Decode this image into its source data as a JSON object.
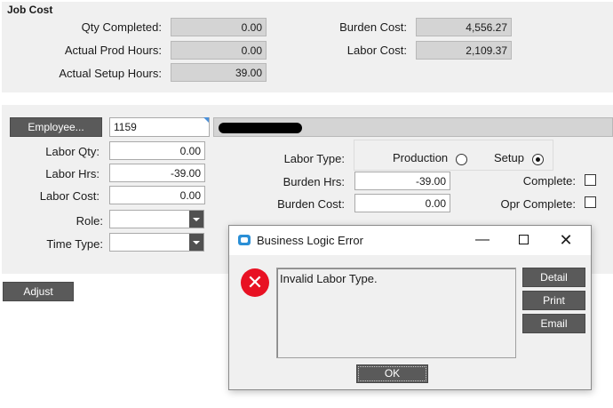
{
  "job_cost": {
    "title": "Job Cost",
    "qty_completed_label": "Qty Completed:",
    "qty_completed_value": "0.00",
    "actual_prod_hours_label": "Actual Prod Hours:",
    "actual_prod_hours_value": "0.00",
    "actual_setup_hours_label": "Actual Setup Hours:",
    "actual_setup_hours_value": "39.00",
    "burden_cost_label": "Burden Cost:",
    "burden_cost_value": "4,556.27",
    "labor_cost_label": "Labor Cost:",
    "labor_cost_value": "2,109.37"
  },
  "labor": {
    "employee_button": "Employee...",
    "employee_id": "1159",
    "labor_qty_label": "Labor Qty:",
    "labor_qty_value": "0.00",
    "labor_hrs_label": "Labor Hrs:",
    "labor_hrs_value": "-39.00",
    "labor_cost_label": "Labor Cost:",
    "labor_cost_value": "0.00",
    "role_label": "Role:",
    "role_value": "",
    "time_type_label": "Time Type:",
    "time_type_value": "",
    "labor_type_label": "Labor Type:",
    "production_label": "Production",
    "setup_label": "Setup",
    "labor_type_selected": "Setup",
    "burden_hrs_label": "Burden Hrs:",
    "burden_hrs_value": "-39.00",
    "burden_cost_label": "Burden Cost:",
    "burden_cost_value": "0.00",
    "complete_label": "Complete:",
    "complete_checked": false,
    "opr_complete_label": "Opr Complete:",
    "opr_complete_checked": false
  },
  "adjust_button": "Adjust",
  "dialog": {
    "title": "Business Logic Error",
    "message": "Invalid Labor Type.",
    "detail_button": "Detail",
    "print_button": "Print",
    "email_button": "Email",
    "ok_button": "OK",
    "icon": "error-x-icon",
    "error_color": "#e81123"
  }
}
